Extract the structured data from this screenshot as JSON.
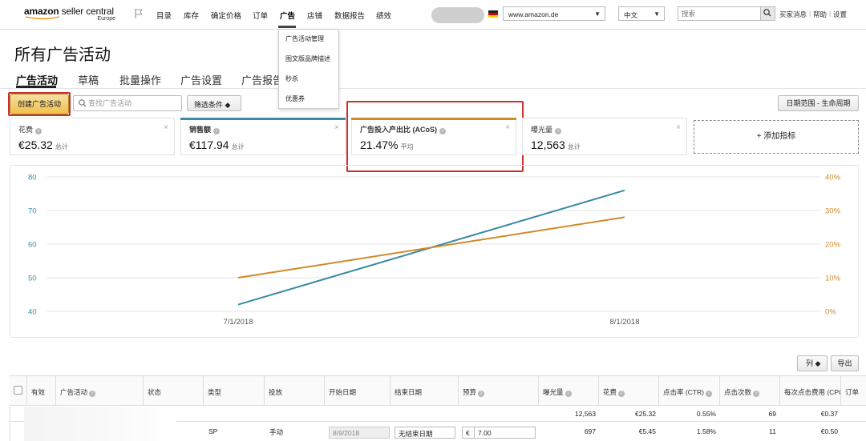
{
  "topbar": {
    "logo_main": "amazon",
    "logo_rest": " seller central",
    "logo_region": "Europe",
    "nav": [
      "目录",
      "库存",
      "确定价格",
      "订单",
      "广告",
      "店铺",
      "数据报告",
      "绩效"
    ],
    "marketplace": "www.amazon.de",
    "language": "中文",
    "search_placeholder": "搜索",
    "links": [
      "买家消息",
      "帮助",
      "设置"
    ]
  },
  "ads_menu": {
    "items": [
      "广告活动管理",
      "图文版品牌描述",
      "秒杀",
      "优惠券"
    ]
  },
  "page": {
    "title": "所有广告活动",
    "tabs": [
      "广告活动",
      "草稿",
      "批量操作",
      "广告设置",
      "广告报告"
    ]
  },
  "controls": {
    "create_label": "创建广告活动",
    "search_placeholder": "查找广告活动",
    "filter_label": "筛选条件 ◆",
    "date_range_label": "日期范围 - 生命周期"
  },
  "metrics": [
    {
      "label": "花费",
      "value": "€25.32",
      "unit": "总计",
      "color": ""
    },
    {
      "label": "销售额",
      "value": "€117.94",
      "unit": "总计",
      "color": "#3b8aa6"
    },
    {
      "label": "广告投入产出比 (ACoS)",
      "value": "21.47%",
      "unit": "平均",
      "color": "#d08a2b"
    },
    {
      "label": "曝光量",
      "value": "12,563",
      "unit": "总计",
      "color": ""
    }
  ],
  "add_metric_label": "+ 添加指标",
  "chart_data": {
    "type": "line",
    "x": [
      "7/1/2018",
      "8/1/2018"
    ],
    "left_axis": {
      "ticks": [
        40,
        50,
        60,
        70,
        80
      ],
      "ylim": [
        40,
        80
      ],
      "color": "#3b8aa6"
    },
    "right_axis": {
      "ticks": [
        "0%",
        "10%",
        "20%",
        "30%",
        "40%"
      ],
      "ylim": [
        0,
        40
      ],
      "color": "#d08a2b"
    },
    "series": [
      {
        "values": [
          42,
          76
        ],
        "axis": "left",
        "color": "#3b8aa6"
      },
      {
        "values": [
          10,
          28
        ],
        "axis": "right",
        "color": "#d08a2b"
      }
    ],
    "grid": true
  },
  "table": {
    "col_button": "列 ◆",
    "export_button": "导出",
    "headers": [
      "有效",
      "广告活动",
      "状态",
      "类型",
      "投放",
      "开始日期",
      "结束日期",
      "预算",
      "曝光量",
      "花费",
      "点击率 (CTR)",
      "点击次数",
      "每次点击费用 (CPC)",
      "订单"
    ],
    "total_row": {
      "impressions": "12,563",
      "spend": "€25.32",
      "ctr": "0.55%",
      "clicks": "69",
      "cpc": "€0.37"
    },
    "rows": [
      {
        "type": "SP",
        "targeting": "手动",
        "start": "8/9/2018",
        "end": "无结束日期",
        "currency": "€",
        "budget": "7.00",
        "impressions": "697",
        "spend": "€5.45",
        "ctr": "1.58%",
        "clicks": "11",
        "cpc": "€0.50"
      }
    ]
  }
}
